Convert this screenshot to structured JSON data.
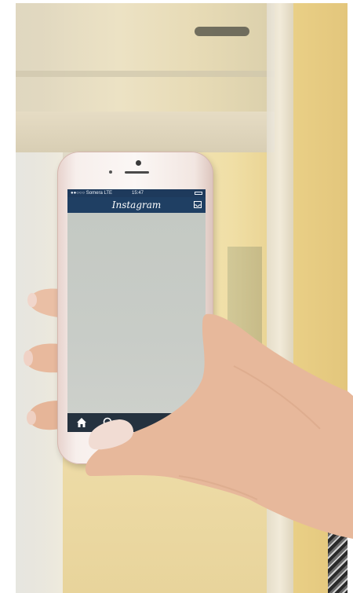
{
  "status_bar": {
    "carrier": "●●○○○ Somera  LTE",
    "time": "15:47"
  },
  "app": {
    "title": "Instagram"
  },
  "icons": {
    "inbox": "inbox-icon",
    "home": "home-icon",
    "search": "search-icon"
  },
  "colors": {
    "header": "#1f3f63",
    "tab_bar": "#25323f",
    "feed": "#c7ccc6"
  }
}
